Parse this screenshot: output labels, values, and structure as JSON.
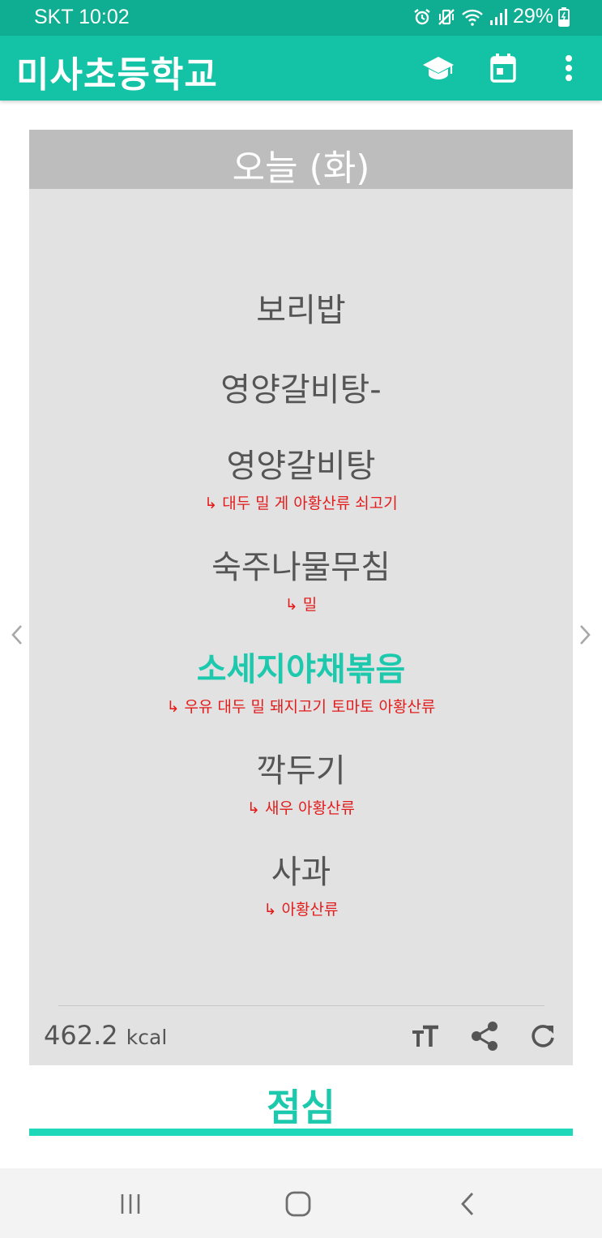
{
  "status_bar": {
    "carrier_time": "SKT 10:02",
    "battery": "29%",
    "icons": [
      "alarm-icon",
      "vibrate-mute-icon",
      "wifi-icon",
      "signal-icon",
      "battery-charging-icon"
    ]
  },
  "app_bar": {
    "title": "미사초등학교",
    "icons": [
      "school-icon",
      "calendar-icon",
      "more-vert-icon"
    ]
  },
  "card": {
    "date_label": "오늘 (화)",
    "menu": [
      {
        "dish": "보리밥",
        "allergy": "",
        "highlight": false
      },
      {
        "dish": "영양갈비탕-",
        "allergy": "",
        "highlight": false
      },
      {
        "dish": "영양갈비탕",
        "allergy": "↳ 대두 밀 게 아황산류 쇠고기",
        "highlight": false
      },
      {
        "dish": "숙주나물무침",
        "allergy": "↳ 밀",
        "highlight": false
      },
      {
        "dish": "소세지야채볶음",
        "allergy": "↳ 우유 대두 밀 돼지고기 토마토 아황산류",
        "highlight": true
      },
      {
        "dish": "깍두기",
        "allergy": "↳ 새우 아황산류",
        "highlight": false
      },
      {
        "dish": "사과",
        "allergy": "↳ 아황산류",
        "highlight": false
      }
    ],
    "calories_value": "462.2",
    "calories_unit": "kcal",
    "icons": [
      "text-size-icon",
      "share-icon",
      "refresh-icon"
    ]
  },
  "navigation_arrows": [
    "chevron-left-icon",
    "chevron-right-icon"
  ],
  "meal_tab": {
    "label": "점심"
  },
  "nav_bar": {
    "icons": [
      "recent-apps-icon",
      "home-icon",
      "back-icon"
    ]
  },
  "colors": {
    "status_bar": "#0fae92",
    "app_bar": "#14c3a6",
    "accent": "#1dc9ad",
    "allergy_text": "#e31b1b",
    "card_bg": "#e2e2e2",
    "card_header": "#bdbdbd"
  }
}
